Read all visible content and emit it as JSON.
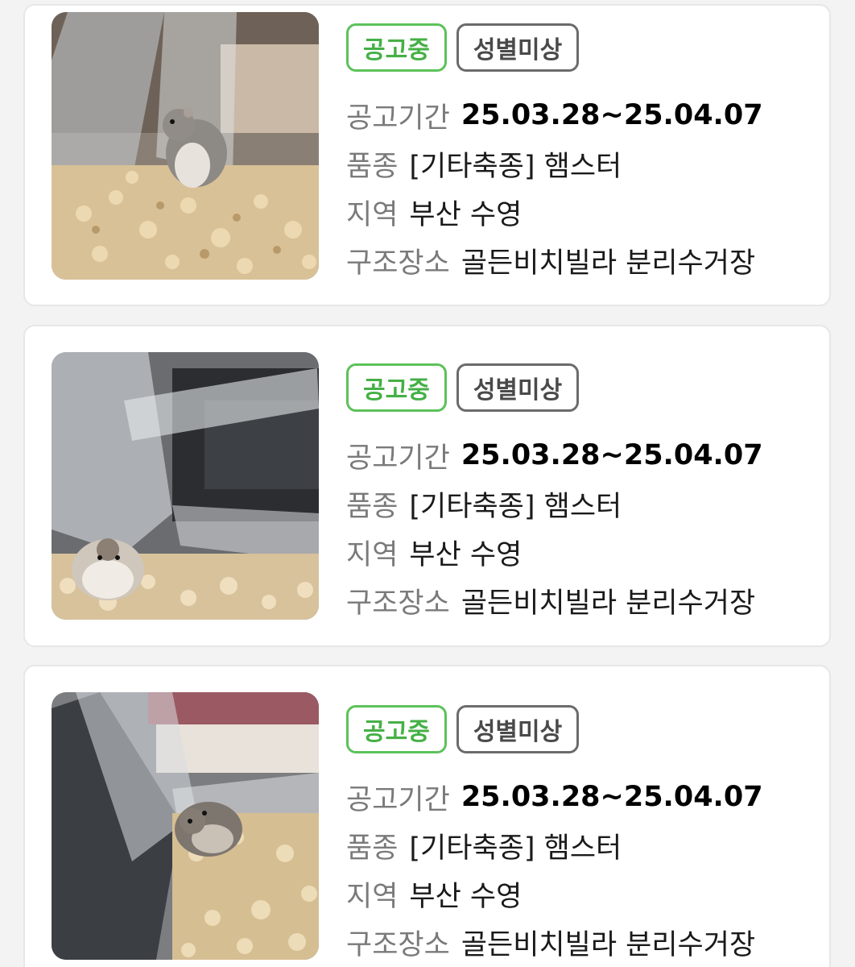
{
  "listings": [
    {
      "status": "공고중",
      "sex": "성별미상",
      "period_label": "공고기간",
      "period_value": "25.03.28~25.04.07",
      "breed_label": "품종",
      "breed_value": "[기타축종] 햄스터",
      "region_label": "지역",
      "region_value": "부산 수영",
      "rescue_label": "구조장소",
      "rescue_value": "골든비치빌라 분리수거장"
    },
    {
      "status": "공고중",
      "sex": "성별미상",
      "period_label": "공고기간",
      "period_value": "25.03.28~25.04.07",
      "breed_label": "품종",
      "breed_value": "[기타축종] 햄스터",
      "region_label": "지역",
      "region_value": "부산 수영",
      "rescue_label": "구조장소",
      "rescue_value": "골든비치빌라 분리수거장"
    },
    {
      "status": "공고중",
      "sex": "성별미상",
      "period_label": "공고기간",
      "period_value": "25.03.28~25.04.07",
      "breed_label": "품종",
      "breed_value": "[기타축종] 햄스터",
      "region_label": "지역",
      "region_value": "부산 수영",
      "rescue_label": "구조장소",
      "rescue_value": "골든비치빌라 분리수거장"
    }
  ],
  "colors": {
    "status_green": "#45b045",
    "badge_gray": "#6b6b6b",
    "label_gray": "#7a7a7a"
  }
}
